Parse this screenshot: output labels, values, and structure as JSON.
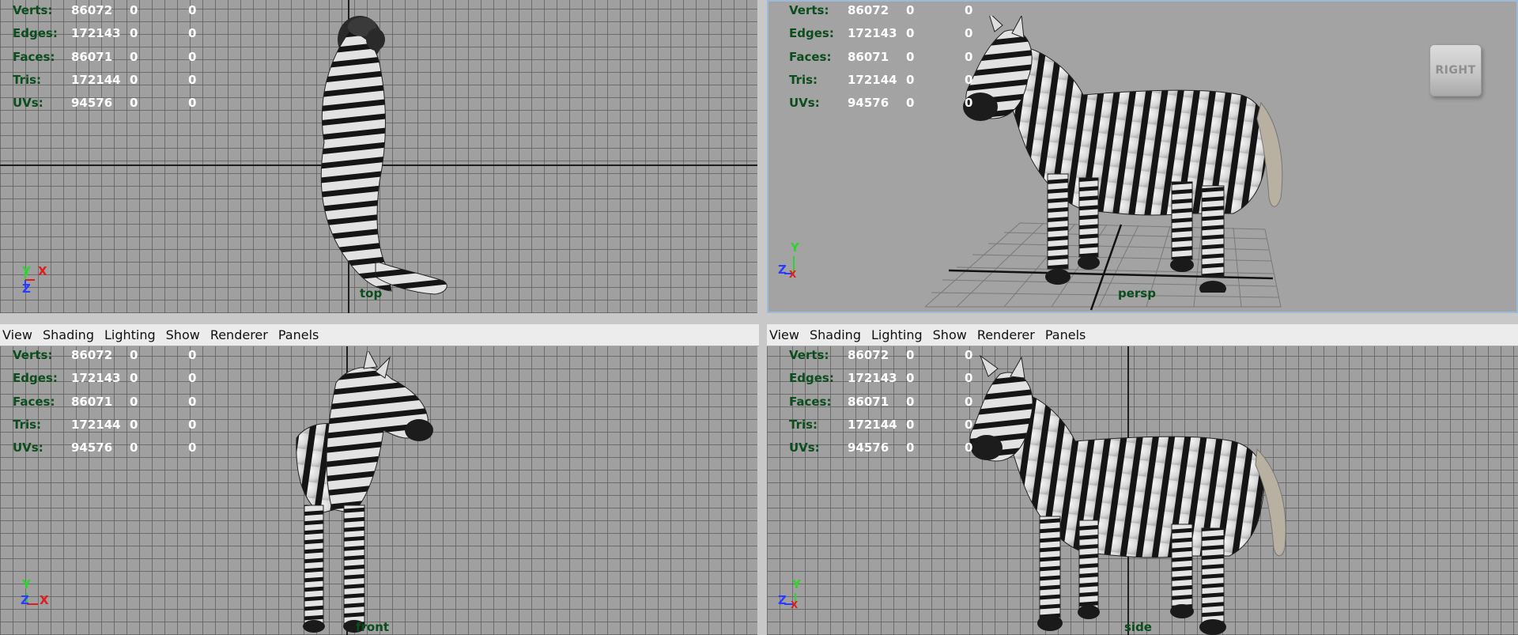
{
  "menu": {
    "view": "View",
    "shading": "Shading",
    "lighting": "Lighting",
    "show": "Show",
    "renderer": "Renderer",
    "panels": "Panels"
  },
  "hud": {
    "rows": [
      {
        "label": "Verts:",
        "v1": "86072",
        "v2": "0",
        "v3": "0"
      },
      {
        "label": "Edges:",
        "v1": "172143",
        "v2": "0",
        "v3": "0"
      },
      {
        "label": "Faces:",
        "v1": "86071",
        "v2": "0",
        "v3": "0"
      },
      {
        "label": "Tris:",
        "v1": "172144",
        "v2": "0",
        "v3": "0"
      },
      {
        "label": "UVs:",
        "v1": "94576",
        "v2": "0",
        "v3": "0"
      }
    ]
  },
  "viewports": {
    "top": {
      "camera": "top"
    },
    "persp": {
      "camera": "persp"
    },
    "front": {
      "camera": "front"
    },
    "side": {
      "camera": "side"
    }
  },
  "viewcube": {
    "face": "RIGHT"
  },
  "gizmo": {
    "x": "X",
    "y": "Y",
    "z": "Z"
  },
  "colors": {
    "hud_label": "#0b4d1c",
    "viewport_bg": "#a0a0a0",
    "active_border": "#9fb9d8",
    "axis_x": "#e01c1c",
    "axis_y": "#2ad62a",
    "axis_z": "#2c3cff"
  }
}
